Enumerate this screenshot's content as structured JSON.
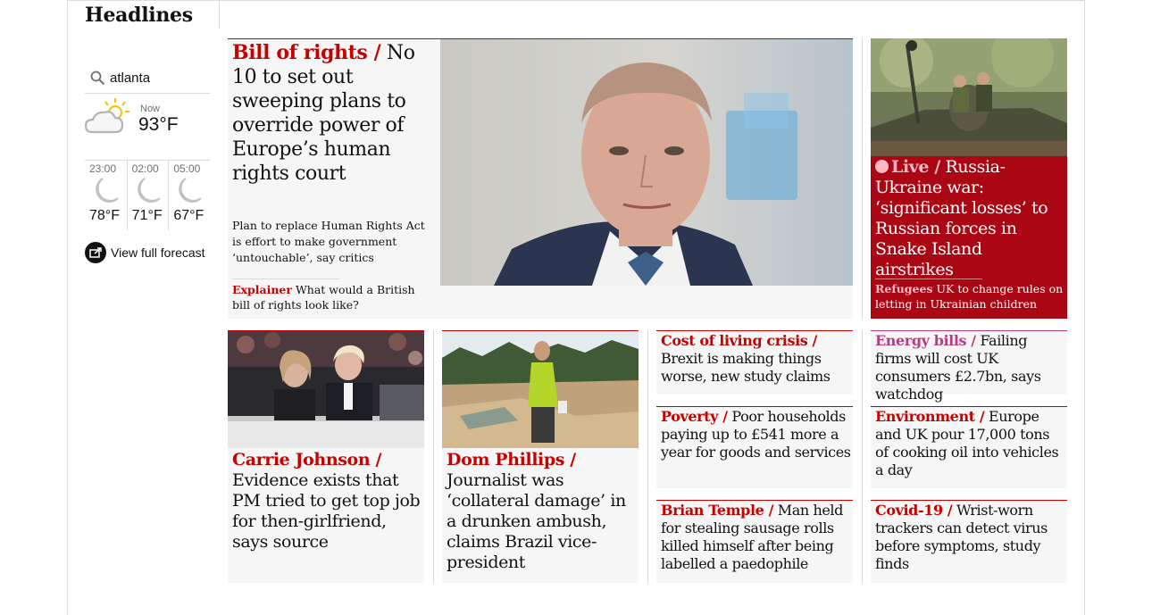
{
  "section": {
    "title": "Headlines"
  },
  "weather": {
    "search_value": "atlanta",
    "now_label": "Now",
    "now_temp": "93°F",
    "forecast": [
      {
        "time": "23:00",
        "temp": "78°F",
        "icon": "moon-icon"
      },
      {
        "time": "02:00",
        "temp": "71°F",
        "icon": "moon-icon"
      },
      {
        "time": "05:00",
        "temp": "67°F",
        "icon": "moon-icon"
      }
    ],
    "full_forecast_label": "View full forecast"
  },
  "main_story": {
    "kicker": "Bill of rights /",
    "headline": "No 10 to set out sweeping plans to override power of Europe’s human rights court",
    "standfirst": "Plan to replace Human Rights Act is effort to make government ‘untouchable’, say critics",
    "sub_kicker": "Explainer",
    "sub_headline": "What would a British bill of rights look like?"
  },
  "live_story": {
    "kicker": "Live /",
    "headline": "Russia-Ukraine war: ‘significant losses’ to Russian forces in Snake Island airstrikes",
    "sub_kicker": "Refugees",
    "sub_headline": "UK to change rules on letting in Ukrainian children"
  },
  "image_stories": [
    {
      "kicker": "Carrie Johnson /",
      "headline": "Evidence exists that PM tried to get top job for then-girlfriend, says source"
    },
    {
      "kicker": "Dom Phillips  /",
      "headline": "Journalist was ‘collateral damage’ in a drunken ambush, claims Brazil vice-president"
    }
  ],
  "small_stories": [
    {
      "kicker": "Cost of living crisis /",
      "headline": "Brexit is making things worse, new study claims"
    },
    {
      "kicker": "Energy bills /",
      "headline": "Failing firms will cost UK consumers £2.7bn, says watchdog"
    },
    {
      "kicker": "Poverty /",
      "headline": "Poor households paying up to £541 more a year for goods and services"
    },
    {
      "kicker": "Environment /",
      "headline": "Europe and UK pour 17,000 tons of cooking oil into vehicles a day"
    },
    {
      "kicker": "Brian Temple /",
      "headline": "Man held for stealing sausage rolls killed himself after being labelled a paedophile"
    },
    {
      "kicker": "Covid-19 /",
      "headline": "Wrist-worn trackers can detect virus before symptoms, study finds"
    }
  ],
  "colors": {
    "news_red": "#c70000",
    "live_bg": "#ab0613",
    "live_pink": "#ffbac8",
    "lifestyle_pink": "#bb3b80"
  }
}
